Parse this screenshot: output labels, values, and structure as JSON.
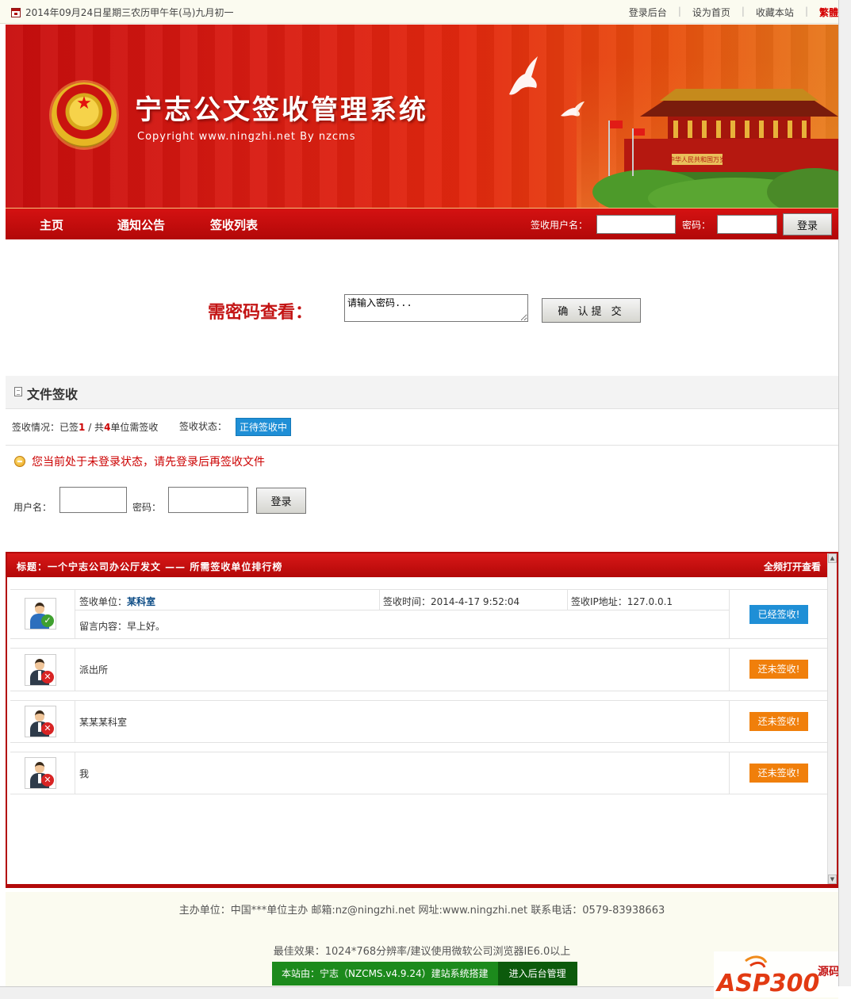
{
  "topbar": {
    "date": "2014年09月24日星期三农历甲午年(马)九月初一",
    "links": [
      "登录后台",
      "设为首页",
      "收藏本站"
    ],
    "trad_link": "繁體"
  },
  "banner": {
    "title": "宁志公文签收管理系统",
    "copyright": "Copyright  www.ningzhi.net By nzcms",
    "gate_text": "中华人民共和国万岁"
  },
  "nav": {
    "items": [
      "主页",
      "通知公告",
      "签收列表"
    ],
    "user_label": "签收用户名：",
    "pass_label": "密码：",
    "login_label": "登录"
  },
  "password_view": {
    "title": "需密码查看：",
    "input_value": "请输入密码...",
    "submit_label": "确 认提 交"
  },
  "file_sign": {
    "heading": "文件签收",
    "status_prefix": "签收情况：已签",
    "signed": "1",
    "status_mid": " / 共",
    "total": "4",
    "status_suffix": "单位需签收",
    "state_label": "签收状态：",
    "state_value": "正待签收中",
    "warning": "您当前处于未登录状态，请先登录后再签收文件",
    "user_label": "用户名：",
    "pass_label": "密码：",
    "login_label": "登录"
  },
  "ranking": {
    "heading": "标题：一个宁志公司办公厅发文  ——  所需签收单位排行榜",
    "open_all": "全频打开查看",
    "first_row": {
      "unit_label": "签收单位：",
      "unit": "某科室",
      "time_label": "签收时间：",
      "time": "2014-4-17 9:52:04",
      "ip_label": "签收IP地址：",
      "ip": "127.0.0.1",
      "message_label": "留言内容：",
      "message": "早上好。",
      "status": "已经签收!"
    },
    "rows": [
      {
        "unit": "派出所",
        "status": "还未签收!"
      },
      {
        "unit": "某某某科室",
        "status": "还未签收!"
      },
      {
        "unit": "我",
        "status": "还未签收!"
      }
    ]
  },
  "footer": {
    "line1": "主办单位：中国***单位主办  邮箱:nz@ningzhi.net  网址:www.ningzhi.net   联系电话：0579-83938663",
    "line2": "最佳效果：1024*768分辨率/建议使用微软公司浏览器IE6.0以上",
    "built_by": "本站由：宁志（NZCMS.v4.9.24）建站系统搭建",
    "admin_link": "进入后台管理",
    "watermark": "ASP300源码"
  },
  "colors": {
    "brand_red": "#c80e0e",
    "signed_blue": "#1f8fd6",
    "unsigned_orange": "#f07f0b",
    "footer_green": "#1c8a1c"
  }
}
